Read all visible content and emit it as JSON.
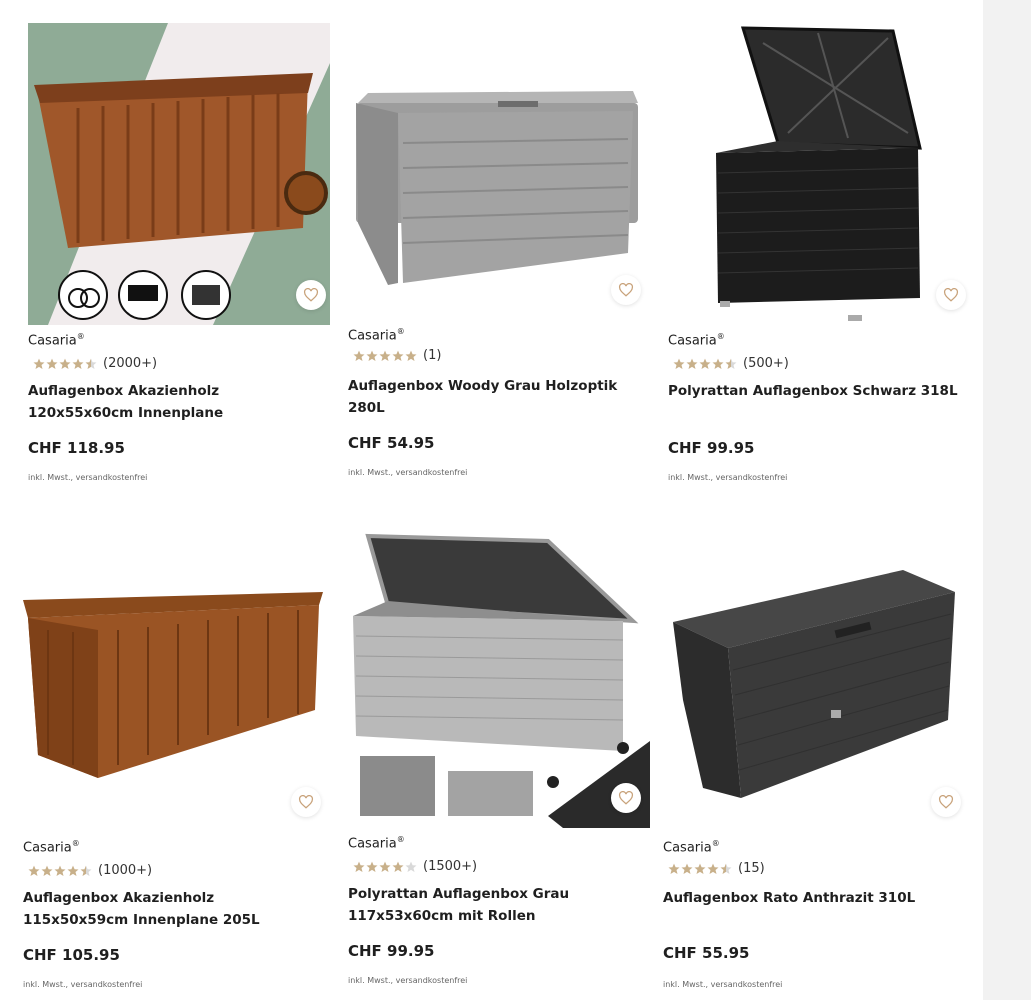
{
  "colors": {
    "star": "#c8b08a",
    "star_empty": "#d9d9d9",
    "heart": "#c8a27a"
  },
  "products": [
    {
      "brand": "Casaria",
      "reg": "®",
      "rating": 4.5,
      "count": "(2000+)",
      "title": "Auflagenbox Akazienholz 120x55x60cm Innenplane",
      "price": "CHF 118.95",
      "note": "inkl. Mwst., versandkostenfrei",
      "image_icon": "wooden-box-image"
    },
    {
      "brand": "Casaria",
      "reg": "®",
      "rating": 5,
      "count": "(1)",
      "title": "Auflagenbox Woody Grau Holzoptik 280L",
      "price": "CHF 54.95",
      "note": "inkl. Mwst., versandkostenfrei",
      "image_icon": "grey-box-image"
    },
    {
      "brand": "Casaria",
      "reg": "®",
      "rating": 4.5,
      "count": "(500+)",
      "title": "Polyrattan Auflagenbox Schwarz 318L",
      "price": "CHF 99.95",
      "note": "inkl. Mwst., versandkostenfrei",
      "image_icon": "black-rattan-box-image"
    },
    {
      "brand": "Casaria",
      "reg": "®",
      "rating": 4.5,
      "count": "(1000+)",
      "title": "Auflagenbox Akazienholz 115x50x59cm Innenplane 205L",
      "price": "CHF 105.95",
      "note": "inkl. Mwst., versandkostenfrei",
      "image_icon": "wooden-box-image"
    },
    {
      "brand": "Casaria",
      "reg": "®",
      "rating": 4,
      "count": "(1500+)",
      "title": "Polyrattan Auflagenbox Grau 117x53x60cm mit Rollen",
      "price": "CHF 99.95",
      "note": "inkl. Mwst., versandkostenfrei",
      "image_icon": "grey-rattan-box-image"
    },
    {
      "brand": "Casaria",
      "reg": "®",
      "rating": 4.5,
      "count": "(15)",
      "title": "Auflagenbox Rato Anthrazit 310L",
      "price": "CHF 55.95",
      "note": "inkl. Mwst., versandkostenfrei",
      "image_icon": "anthracite-box-image"
    }
  ]
}
